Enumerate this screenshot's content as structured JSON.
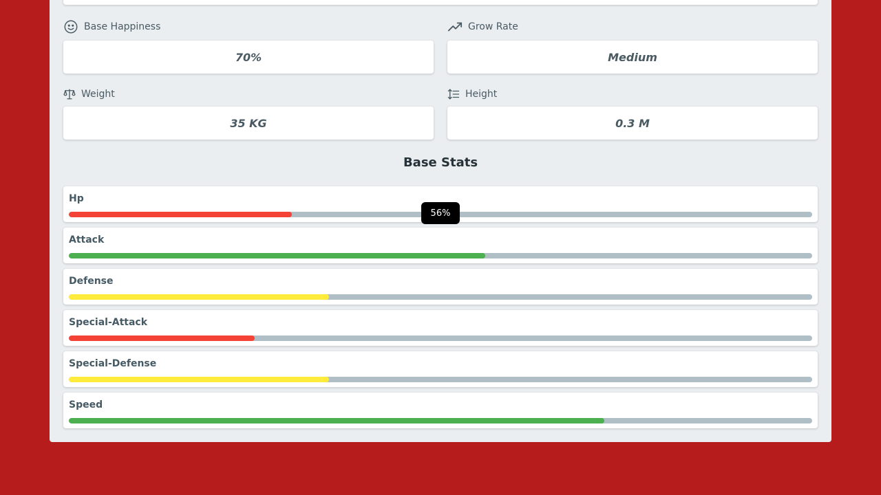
{
  "details": {
    "base_happiness": {
      "label": "Base Happiness",
      "value": "70%",
      "icon": "smile-icon"
    },
    "grow_rate": {
      "label": "Grow Rate",
      "value": "Medium",
      "icon": "trending-up-icon"
    },
    "weight": {
      "label": "Weight",
      "value": "35 KG",
      "icon": "scale-icon"
    },
    "height": {
      "label": "Height",
      "value": "0.3 M",
      "icon": "line-spacing-icon"
    }
  },
  "base_stats": {
    "title": "Base Stats",
    "tooltip": "56%",
    "items": [
      {
        "name": "Hp",
        "percent": 30,
        "color": "#f44336"
      },
      {
        "name": "Attack",
        "percent": 56,
        "color": "#4caf50"
      },
      {
        "name": "Defense",
        "percent": 35,
        "color": "#ffeb3b"
      },
      {
        "name": "Special-Attack",
        "percent": 25,
        "color": "#f44336"
      },
      {
        "name": "Special-Defense",
        "percent": 35,
        "color": "#ffeb3b"
      },
      {
        "name": "Speed",
        "percent": 72,
        "color": "#4caf50"
      }
    ]
  }
}
